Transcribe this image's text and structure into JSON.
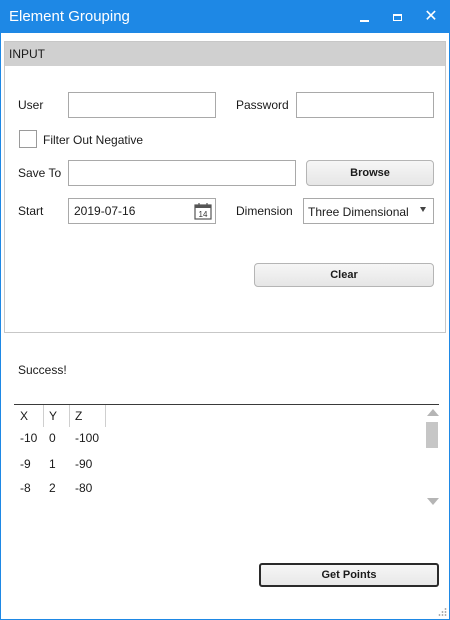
{
  "window": {
    "title": "Element Grouping"
  },
  "input_panel": {
    "header": "INPUT",
    "user_label": "User",
    "user_value": "",
    "password_label": "Password",
    "password_value": "",
    "filter_label": "Filter Out Negative",
    "filter_checked": false,
    "save_to_label": "Save To",
    "save_to_value": "",
    "browse_label": "Browse",
    "start_label": "Start",
    "start_value": "2019-07-16",
    "calendar_icon_day": "14",
    "dimension_label": "Dimension",
    "dimension_value": "Three Dimensional",
    "clear_label": "Clear"
  },
  "status_text": "Success!",
  "grid": {
    "columns": [
      "X",
      "Y",
      "Z"
    ],
    "rows": [
      [
        "-10",
        "0",
        "-100"
      ],
      [
        "-9",
        "1",
        "-90"
      ],
      [
        "-8",
        "2",
        "-80"
      ]
    ]
  },
  "get_points_label": "Get Points",
  "colors": {
    "titlebar": "#1e88e5",
    "panel_header": "#d0d0d0"
  }
}
